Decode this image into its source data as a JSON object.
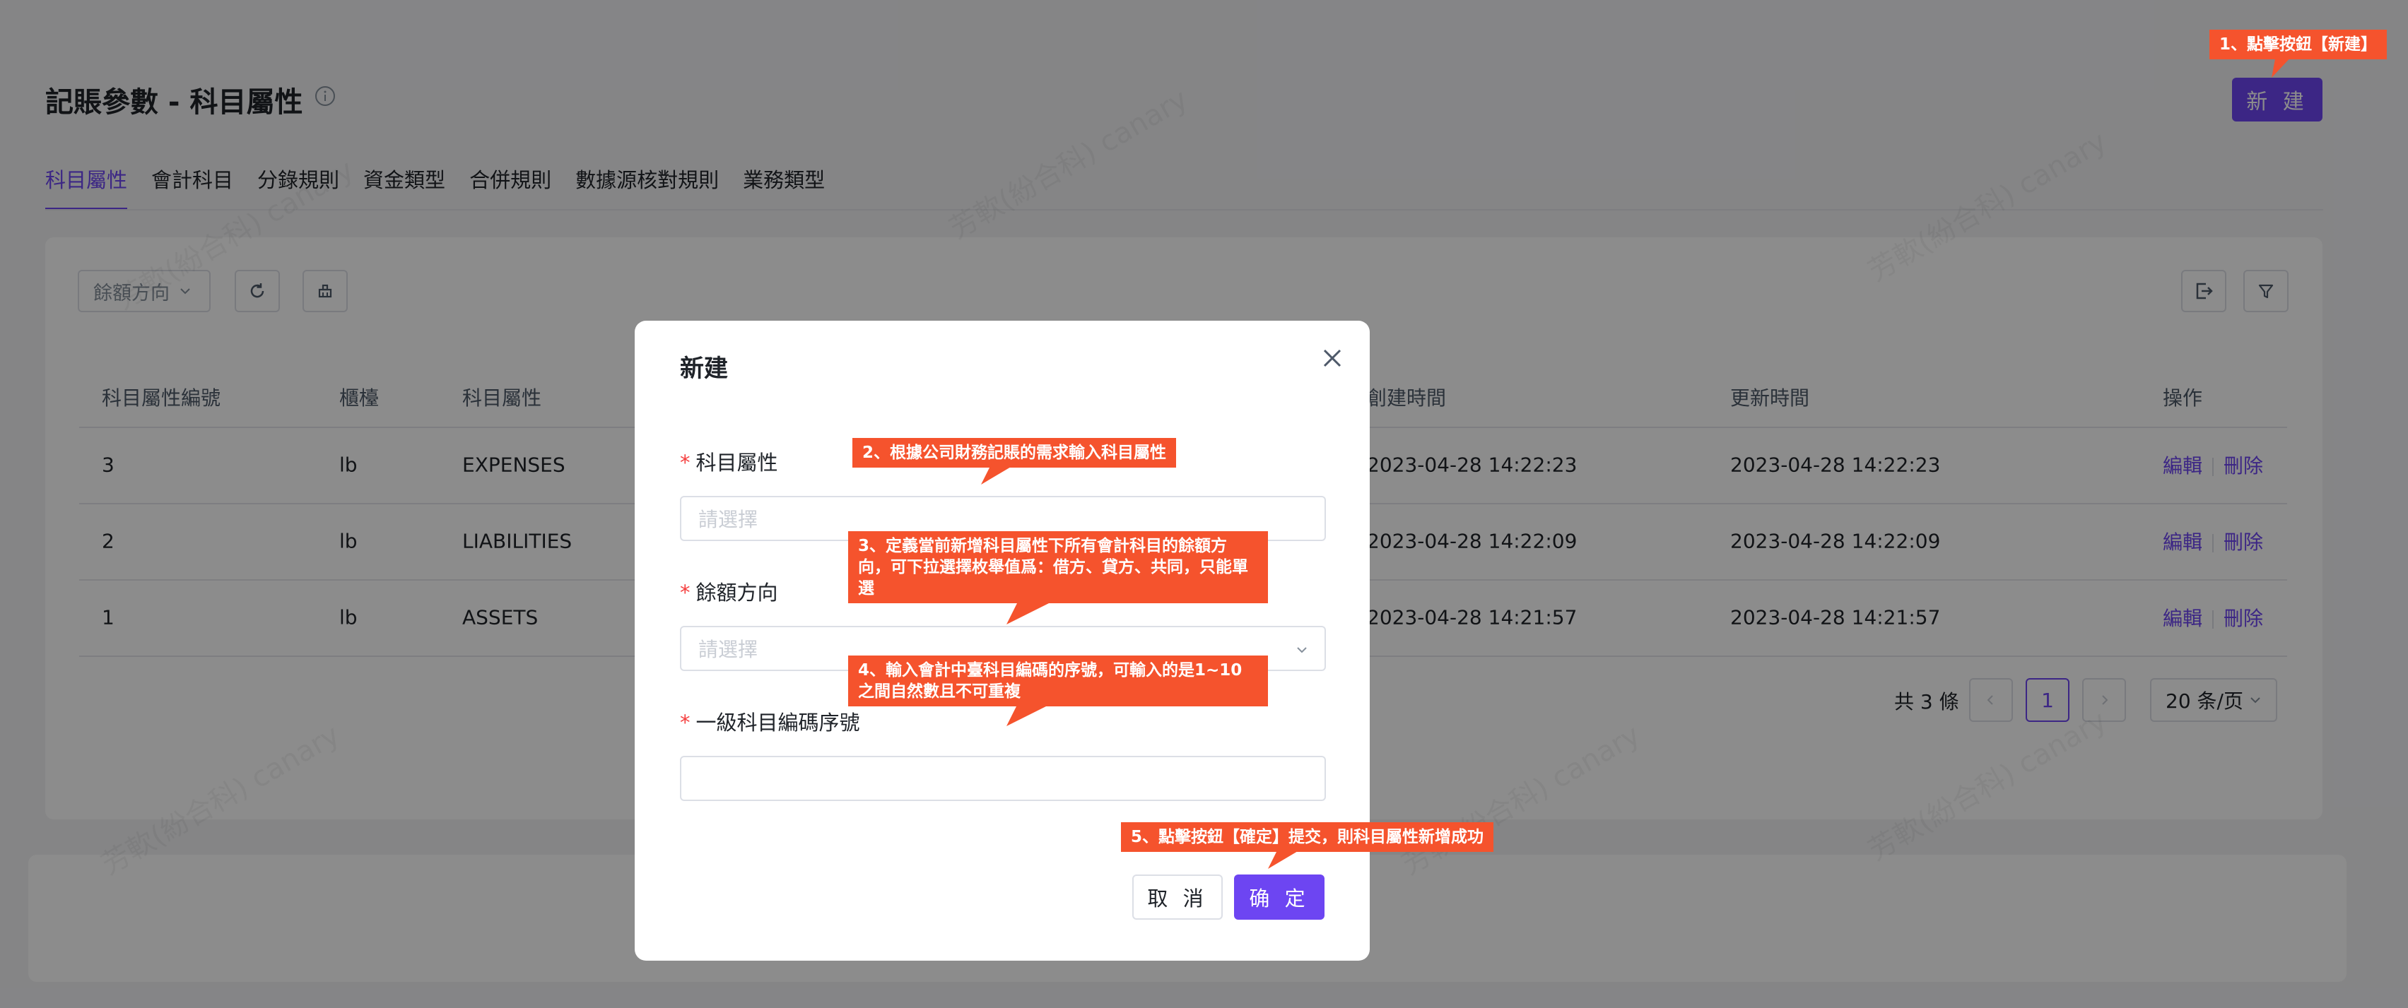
{
  "page": {
    "title": "記賬參數 - 科目屬性",
    "new_button": "新 建"
  },
  "tabs": [
    {
      "label": "科目屬性",
      "active": true
    },
    {
      "label": "會計科目"
    },
    {
      "label": "分錄規則"
    },
    {
      "label": "資金類型"
    },
    {
      "label": "合併規則"
    },
    {
      "label": "數據源核對規則"
    },
    {
      "label": "業務類型"
    }
  ],
  "toolbar": {
    "filter_label": "餘額方向"
  },
  "table": {
    "headers": [
      "科目屬性編號",
      "櫃檯",
      "科目屬性",
      "創建時間",
      "更新時間",
      "操作"
    ],
    "rows": [
      {
        "id": "3",
        "counter": "lb",
        "attr": "EXPENSES",
        "created": "2023-04-28 14:22:23",
        "updated": "2023-04-28 14:22:23"
      },
      {
        "id": "2",
        "counter": "lb",
        "attr": "LIABILITIES",
        "created": "2023-04-28 14:22:09",
        "updated": "2023-04-28 14:22:09"
      },
      {
        "id": "1",
        "counter": "lb",
        "attr": "ASSETS",
        "created": "2023-04-28 14:21:57",
        "updated": "2023-04-28 14:21:57"
      }
    ],
    "edit_label": "編輯",
    "delete_label": "刪除"
  },
  "pagination": {
    "total": "共 3 條",
    "current": "1",
    "page_size": "20 条/页"
  },
  "watermark": "芳軟(紛合科) canary",
  "modal": {
    "title": "新建",
    "field1_label": "科目屬性",
    "field1_placeholder": "請選擇",
    "field2_label": "餘額方向",
    "field2_placeholder": "請選擇",
    "field3_label": "一級科目編碼序號",
    "field3_value": "",
    "cancel": "取 消",
    "ok": "确 定"
  },
  "annotations": [
    "1、點擊按鈕【新建】",
    "2、根據公司財務記賬的需求輸入科目屬性",
    "3、定義當前新增科目屬性下所有會計科目的餘額方向，可下拉選擇枚舉值爲：借方、貸方、共同，只能單選",
    "4、輸入會計中臺科目編碼的序號，可輸入的是1~10之間自然數且不可重複",
    "5、點擊按鈕【確定】提交，則科目屬性新增成功"
  ],
  "colors": {
    "primary": "#6d45f2",
    "annotation": "#f5532d",
    "required": "#f53f3f"
  }
}
